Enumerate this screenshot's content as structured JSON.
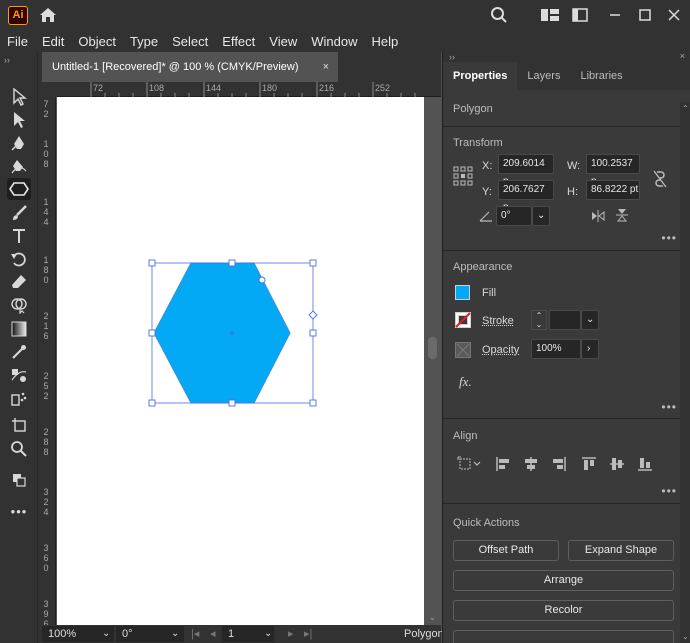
{
  "app": {
    "logo_text": "Ai",
    "accent": "#ff9a00"
  },
  "menu": [
    "File",
    "Edit",
    "Object",
    "Type",
    "Select",
    "Effect",
    "View",
    "Window",
    "Help"
  ],
  "document": {
    "tab_title": "Untitled-1 [Recovered]* @ 100 % (CMYK/Preview)",
    "close_label": "×"
  },
  "ruler": {
    "top_ticks": [
      "72",
      "108",
      "144",
      "180",
      "216",
      "252"
    ],
    "left_ticks": [
      "7\n2",
      "1\n0\n8",
      "1\n4\n4",
      "1\n8\n0",
      "2\n1\n6",
      "2\n5\n2",
      "2\n8\n8",
      "3\n2\n4",
      "3\n6\n0",
      "3\n9\n6"
    ]
  },
  "shape": {
    "type": "hexagon",
    "fill": "#03a9f4",
    "stroke": "#3b8fd9"
  },
  "status": {
    "zoom": "100%",
    "rotation": "0°",
    "artboard": "1",
    "selection_label": "Polygon"
  },
  "panel": {
    "tabs": [
      "Properties",
      "Layers",
      "Libraries"
    ],
    "active_tab": "Properties",
    "object_type": "Polygon",
    "transform": {
      "title": "Transform",
      "x_label": "X:",
      "x_value": "209.6014 p",
      "y_label": "Y:",
      "y_value": "206.7627 p",
      "w_label": "W:",
      "w_value": "100.2537 p",
      "h_label": "H:",
      "h_value": "86.8222 pt",
      "angle_value": "0°"
    },
    "appearance": {
      "title": "Appearance",
      "fill_label": "Fill",
      "fill_color": "#03a9f4",
      "stroke_label": "Stroke",
      "opacity_label": "Opacity",
      "opacity_value": "100%",
      "fx_label": "fx."
    },
    "align": {
      "title": "Align"
    },
    "quick_actions": {
      "title": "Quick Actions",
      "offset_path": "Offset Path",
      "expand_shape": "Expand Shape",
      "arrange": "Arrange",
      "recolor": "Recolor"
    },
    "more_label": "•••"
  }
}
